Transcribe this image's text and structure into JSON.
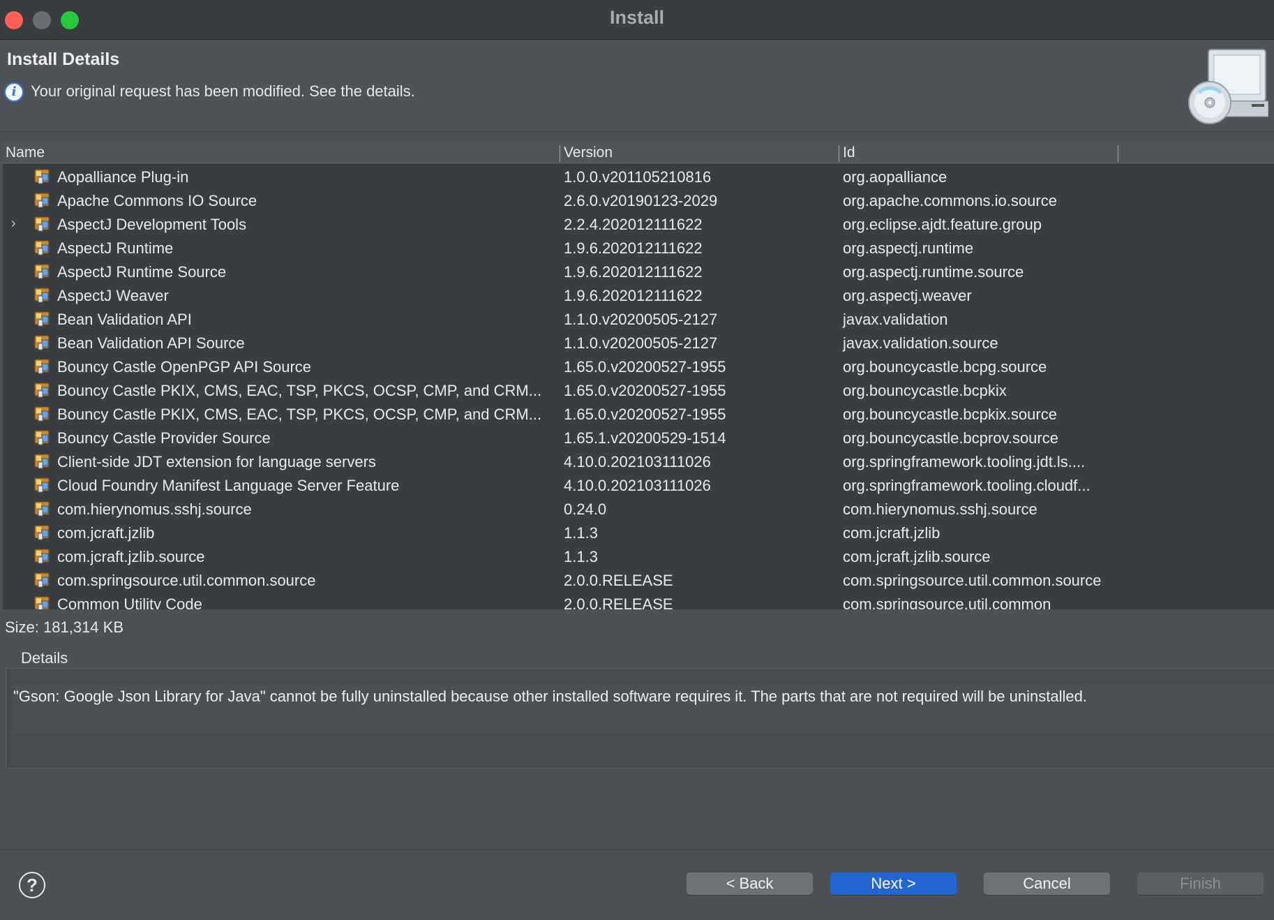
{
  "window": {
    "title": "Install"
  },
  "banner": {
    "title": "Install Details",
    "message": "Your original request has been modified.  See the details.",
    "info_icon": "info-icon",
    "graphic_icon": "install-cd-monitor-icon"
  },
  "table": {
    "columns": [
      "Name",
      "Version",
      "Id"
    ],
    "rows": [
      {
        "name": "Aopalliance Plug-in",
        "version": "1.0.0.v201105210816",
        "id": "org.aopalliance",
        "expandable": false
      },
      {
        "name": "Apache Commons IO Source",
        "version": "2.6.0.v20190123-2029",
        "id": "org.apache.commons.io.source",
        "expandable": false
      },
      {
        "name": "AspectJ Development Tools",
        "version": "2.2.4.202012111622",
        "id": "org.eclipse.ajdt.feature.group",
        "expandable": true
      },
      {
        "name": "AspectJ Runtime",
        "version": "1.9.6.202012111622",
        "id": "org.aspectj.runtime",
        "expandable": false
      },
      {
        "name": "AspectJ Runtime Source",
        "version": "1.9.6.202012111622",
        "id": "org.aspectj.runtime.source",
        "expandable": false
      },
      {
        "name": "AspectJ Weaver",
        "version": "1.9.6.202012111622",
        "id": "org.aspectj.weaver",
        "expandable": false
      },
      {
        "name": "Bean Validation API",
        "version": "1.1.0.v20200505-2127",
        "id": "javax.validation",
        "expandable": false
      },
      {
        "name": "Bean Validation API Source",
        "version": "1.1.0.v20200505-2127",
        "id": "javax.validation.source",
        "expandable": false
      },
      {
        "name": "Bouncy Castle OpenPGP API Source",
        "version": "1.65.0.v20200527-1955",
        "id": "org.bouncycastle.bcpg.source",
        "expandable": false
      },
      {
        "name": "Bouncy Castle PKIX, CMS, EAC, TSP, PKCS, OCSP, CMP, and CRM...",
        "version": "1.65.0.v20200527-1955",
        "id": "org.bouncycastle.bcpkix",
        "expandable": false
      },
      {
        "name": "Bouncy Castle PKIX, CMS, EAC, TSP, PKCS, OCSP, CMP, and CRM...",
        "version": "1.65.0.v20200527-1955",
        "id": "org.bouncycastle.bcpkix.source",
        "expandable": false
      },
      {
        "name": "Bouncy Castle Provider Source",
        "version": "1.65.1.v20200529-1514",
        "id": "org.bouncycastle.bcprov.source",
        "expandable": false
      },
      {
        "name": "Client-side JDT extension for language servers",
        "version": "4.10.0.202103111026",
        "id": "org.springframework.tooling.jdt.ls....",
        "expandable": false
      },
      {
        "name": "Cloud Foundry Manifest Language Server Feature",
        "version": "4.10.0.202103111026",
        "id": "org.springframework.tooling.cloudf...",
        "expandable": false
      },
      {
        "name": "com.hierynomus.sshj.source",
        "version": "0.24.0",
        "id": "com.hierynomus.sshj.source",
        "expandable": false
      },
      {
        "name": "com.jcraft.jzlib",
        "version": "1.1.3",
        "id": "com.jcraft.jzlib",
        "expandable": false
      },
      {
        "name": "com.jcraft.jzlib.source",
        "version": "1.1.3",
        "id": "com.jcraft.jzlib.source",
        "expandable": false
      },
      {
        "name": "com.springsource.util.common.source",
        "version": "2.0.0.RELEASE",
        "id": "com.springsource.util.common.source",
        "expandable": false
      },
      {
        "name": "Common Utility Code",
        "version": "2.0.0.RELEASE",
        "id": "com.springsource.util.common",
        "expandable": false
      }
    ],
    "row_icon": "plugin-feature-icon",
    "expand_icon": "chevron-right-icon"
  },
  "size": {
    "text": "Size: 181,314 KB"
  },
  "details": {
    "label": "Details",
    "text": "\"Gson: Google Json Library for Java\" cannot be fully uninstalled because other installed software requires it.  The parts that are not required will be uninstalled."
  },
  "footer": {
    "help_icon": "help-icon",
    "back_label": "< Back",
    "next_label": "Next >",
    "cancel_label": "Cancel",
    "finish_label": "Finish"
  },
  "colors": {
    "background": "#4d5155",
    "table_background": "#3b3e41",
    "primary_button": "#2366d1",
    "close": "#ff5f57",
    "maximize": "#28c840"
  }
}
